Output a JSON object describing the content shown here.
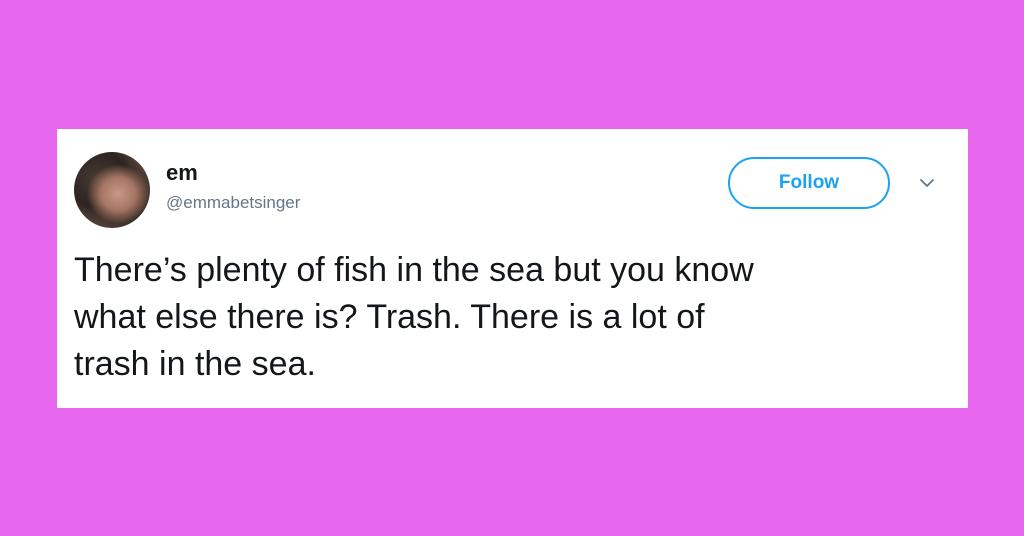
{
  "tweet": {
    "display_name": "em",
    "handle": "@emmabetsinger",
    "follow_label": "Follow",
    "text_lines": [
      "There’s plenty of fish in the sea but you know",
      "what else there is? Trash. There is a lot of",
      "trash in the sea."
    ]
  },
  "icons": {
    "avatar": "profile-photo",
    "chevron": "chevron-down-icon"
  },
  "colors": {
    "background": "#e766ee",
    "card": "#ffffff",
    "accent": "#1da1f2",
    "text": "#14171a",
    "secondary_text": "#657786"
  }
}
